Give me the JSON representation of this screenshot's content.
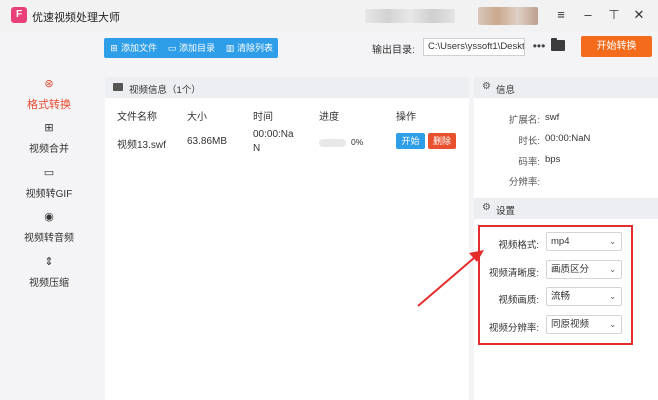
{
  "app": {
    "title": "优速视频处理大师",
    "logo_glyph": "F"
  },
  "window_controls": {
    "menu": "≡",
    "minimize": "–",
    "pin": "⊤",
    "close": "✕"
  },
  "sidebar": {
    "items": [
      {
        "label": "格式转换",
        "icon": "format-convert-icon",
        "glyph": "⊛",
        "active": true
      },
      {
        "label": "视频合并",
        "icon": "merge-icon",
        "glyph": "⊞",
        "active": false
      },
      {
        "label": "视频转GIF",
        "icon": "gif-icon",
        "glyph": "▭",
        "active": false
      },
      {
        "label": "视频转音频",
        "icon": "audio-icon",
        "glyph": "◉",
        "active": false
      },
      {
        "label": "视频压缩",
        "icon": "compress-icon",
        "glyph": "⇕",
        "active": false
      }
    ]
  },
  "toolbar": {
    "add_file": "添加文件",
    "add_folder": "添加目录",
    "clear_list": "清除列表",
    "output_label": "输出目录:",
    "output_path": "C:\\Users\\yssoft1\\Deskt",
    "more": "•••",
    "start_all": "开始转换"
  },
  "list": {
    "header": "视频信息（1个）",
    "columns": [
      "文件名称",
      "大小",
      "时间",
      "进度",
      "操作"
    ],
    "rows": [
      {
        "name": "视频13.swf",
        "size": "63.86MB",
        "time_line1": "00:00:Na",
        "time_line2": "N",
        "progress": 0,
        "progress_text": "0%",
        "start_label": "开始",
        "delete_label": "删除"
      }
    ]
  },
  "info": {
    "title": "信息",
    "items": [
      {
        "key": "扩展名:",
        "value": "swf"
      },
      {
        "key": "时长:",
        "value": "00:00:NaN"
      },
      {
        "key": "码率:",
        "value": "bps"
      },
      {
        "key": "分辨率:",
        "value": ""
      }
    ]
  },
  "settings": {
    "title": "设置",
    "fields": [
      {
        "label": "视频格式:",
        "value": "mp4"
      },
      {
        "label": "视频清晰度:",
        "value": "画质区分"
      },
      {
        "label": "视频画质:",
        "value": "流畅"
      },
      {
        "label": "视频分辨率:",
        "value": "同原视频"
      }
    ]
  },
  "colors": {
    "accent_blue": "#2f9ee8",
    "accent_orange": "#f56b1c",
    "delete_red": "#e8502e",
    "highlight_red": "#e52c2c",
    "active_red": "#e64a2e"
  }
}
